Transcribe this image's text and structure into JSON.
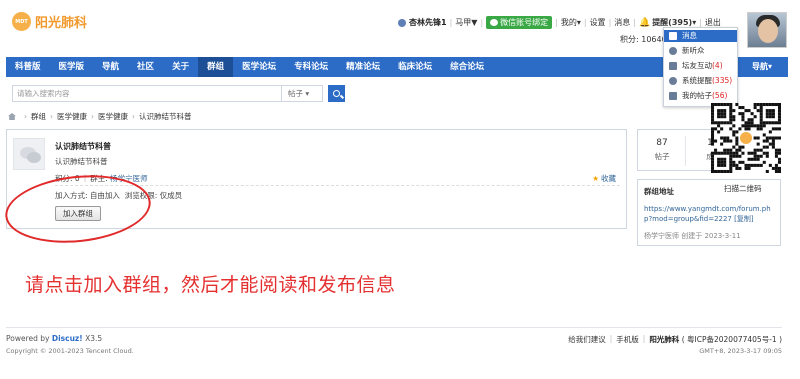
{
  "header": {
    "logo_badge": "MDT",
    "logo_text": "阳光肺科",
    "username": "杏林先锋1",
    "dropdown_user": "马甲▼",
    "wechat_bind": "微信账号绑定",
    "my": "我的▾",
    "settings": "设置",
    "messages": "消息",
    "reminders": "提醒(395)▾",
    "logout": "退出",
    "score": "积分: 10640"
  },
  "nav": {
    "items": [
      "科普版",
      "医学版",
      "导航",
      "社区",
      "关于",
      "群组",
      "医学论坛",
      "专科论坛",
      "精准论坛",
      "临床论坛",
      "综合论坛"
    ],
    "active_index": 5,
    "right_label": "导航▾"
  },
  "search": {
    "placeholder": "请输入搜索内容",
    "type": "帖子 ▾"
  },
  "breadcrumb": [
    "群组",
    "医学健康",
    "医学健康",
    "认识肺结节科普"
  ],
  "group": {
    "title": "认识肺结节科普",
    "description": "认识肺结节科普",
    "score_label": "积分: 0",
    "owner_label": "群主:",
    "owner_name": "杨学宁医师",
    "favorite": "收藏",
    "join_mode": "加入方式: 自由加入",
    "permission": "浏览权限: 仅成员",
    "join_button": "加入群组"
  },
  "stats": [
    {
      "num": "87",
      "label": "帖子"
    },
    {
      "num": "1",
      "label": "成"
    }
  ],
  "address": {
    "title": "群组地址",
    "url": "https://www.yangmdt.com/forum.php?mod=group&fid=2227 [复制]",
    "footer": "杨学宁医师 创建于 2023-3-11"
  },
  "notification_menu": {
    "items": [
      {
        "label": "消息",
        "count": ""
      },
      {
        "label": "新听众",
        "count": ""
      },
      {
        "label": "坛友互动",
        "count": "(4)"
      },
      {
        "label": "系统提醒",
        "count": "(335)"
      },
      {
        "label": "我的帖子",
        "count": "(56)"
      }
    ],
    "close": "×"
  },
  "qr_caption": "扫描二维码",
  "instruction": "请点击加入群组，然后才能阅读和发布信息",
  "footer": {
    "powered_prefix": "Powered by ",
    "powered_brand": "Discuz!",
    "powered_version": " X3.5",
    "copyright": "Copyright © 2001-2023 Tencent Cloud.",
    "links": [
      "给我们建议",
      "手机版"
    ],
    "site_name": "阳光肺科",
    "icp": "( 粤ICP备2020077405号-1 )",
    "time": "GMT+8, 2023-3-17 09:05"
  },
  "colors": {
    "nav": "#2c6cc6",
    "nav_active": "#1d4f97",
    "annotation_red": "#e53030",
    "logo_orange": "#f19a2e",
    "wechat_green": "#39a845"
  }
}
